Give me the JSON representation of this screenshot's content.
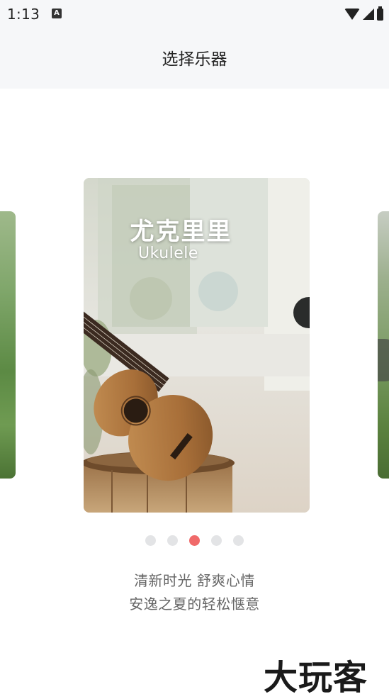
{
  "status_bar": {
    "time": "1:13",
    "notif_icon": "A"
  },
  "header": {
    "title": "选择乐器"
  },
  "carousel": {
    "current_card": {
      "title": "尤克里里",
      "subtitle": "Ukulele"
    },
    "page_count": 5,
    "active_index": 2
  },
  "caption": {
    "line1": "清新时光 舒爽心情",
    "line2": "安逸之夏的轻松惬意"
  },
  "watermark": "大玩客",
  "colors": {
    "dot_active": "#f06a6a",
    "dot_inactive": "#e3e4e6",
    "header_bg": "#f6f7f9"
  }
}
